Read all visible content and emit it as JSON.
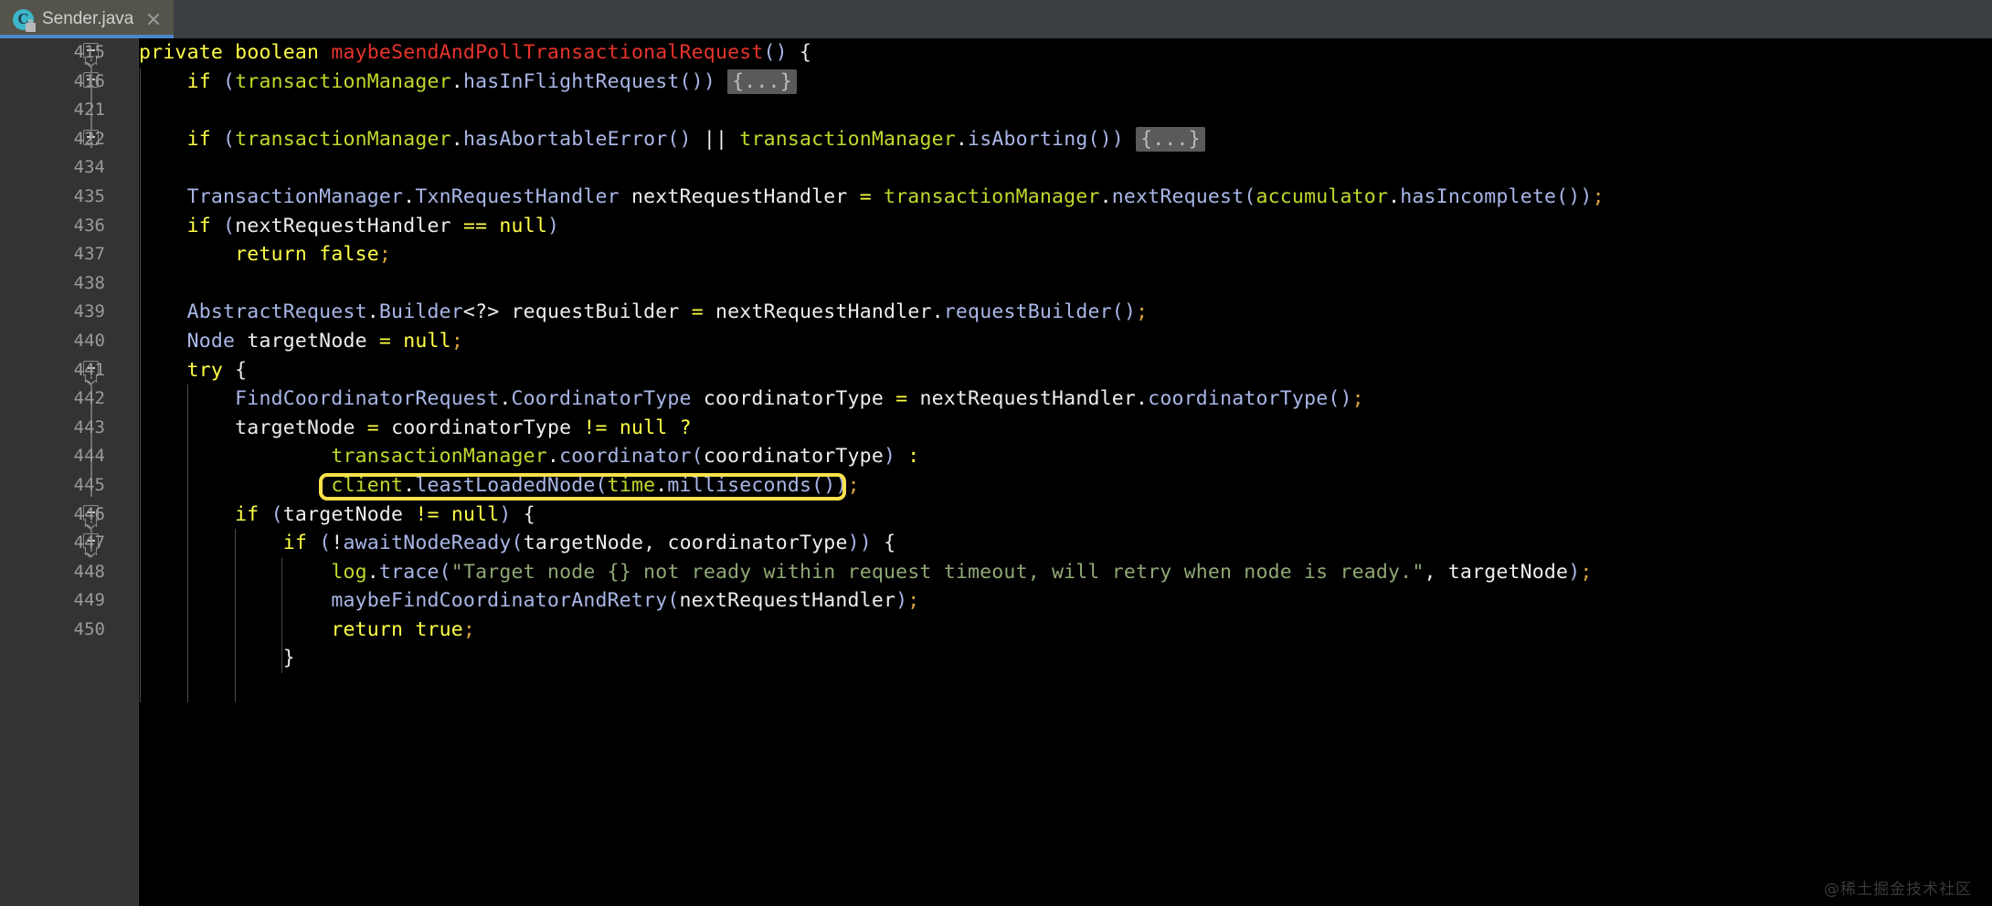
{
  "window": {
    "app": "IntelliJ IDEA Editor",
    "theme_background": "#000000",
    "gutter_background": "#313335",
    "tabbar_background": "#3c3f41"
  },
  "tab": {
    "title": "Sender.java",
    "icon": "java-class-icon",
    "icon_letter": "C",
    "icon_color": "#3eb5c8",
    "lock_badge": "lock-icon",
    "close": "close-icon",
    "active": true,
    "active_underline_color": "#4a88c7"
  },
  "highlight": {
    "color": "#fbe14a",
    "target_text": "client.leastLoadedNode(time.milliseconds())",
    "target_line": "445"
  },
  "watermark": "@稀土掘金技术社区",
  "colors": {
    "keyword": "#ffff45",
    "method_decl": "#e8342c",
    "field": "#c3d82c",
    "method_call": "#a9b7e8",
    "string": "#8fa876",
    "plain": "#e8e8e8",
    "semicolon": "#d8a33c",
    "line_number": "#9a9a9a",
    "fold_placeholder_bg": "#5a5a5a"
  },
  "editor": {
    "fold_placeholder": "{...}",
    "lines": [
      {
        "num": "415",
        "fold": "minus",
        "indent": 0,
        "tokens": [
          {
            "t": "private",
            "c": "kw"
          },
          {
            "t": " ",
            "c": "plain"
          },
          {
            "t": "boolean",
            "c": "kw"
          },
          {
            "t": " ",
            "c": "plain"
          },
          {
            "t": "maybeSendAndPollTransactionalRequest",
            "c": "mdecl"
          },
          {
            "t": "()",
            "c": "punct"
          },
          {
            "t": " ",
            "c": "plain"
          },
          {
            "t": "{",
            "c": "plain"
          }
        ]
      },
      {
        "num": "416",
        "fold": "plus",
        "indent": 1,
        "tokens": [
          {
            "t": "    ",
            "c": "plain"
          },
          {
            "t": "if",
            "c": "kw"
          },
          {
            "t": " ",
            "c": "plain"
          },
          {
            "t": "(",
            "c": "punct"
          },
          {
            "t": "transactionManager",
            "c": "var"
          },
          {
            "t": ".",
            "c": "white"
          },
          {
            "t": "hasInFlightRequest",
            "c": "meth"
          },
          {
            "t": "())",
            "c": "punct"
          },
          {
            "t": " ",
            "c": "plain"
          },
          {
            "t": "{...}",
            "c": "foldph"
          }
        ]
      },
      {
        "num": "421",
        "fold": "",
        "indent": 1,
        "tokens": []
      },
      {
        "num": "422",
        "fold": "plus",
        "indent": 1,
        "tokens": [
          {
            "t": "    ",
            "c": "plain"
          },
          {
            "t": "if",
            "c": "kw"
          },
          {
            "t": " ",
            "c": "plain"
          },
          {
            "t": "(",
            "c": "punct"
          },
          {
            "t": "transactionManager",
            "c": "var"
          },
          {
            "t": ".",
            "c": "white"
          },
          {
            "t": "hasAbortableError",
            "c": "meth"
          },
          {
            "t": "()",
            "c": "punct"
          },
          {
            "t": " ",
            "c": "plain"
          },
          {
            "t": "||",
            "c": "white"
          },
          {
            "t": " ",
            "c": "plain"
          },
          {
            "t": "transactionManager",
            "c": "var"
          },
          {
            "t": ".",
            "c": "white"
          },
          {
            "t": "isAborting",
            "c": "meth"
          },
          {
            "t": "())",
            "c": "punct"
          },
          {
            "t": " ",
            "c": "plain"
          },
          {
            "t": "{...}",
            "c": "foldph"
          }
        ]
      },
      {
        "num": "434",
        "fold": "",
        "indent": 1,
        "tokens": []
      },
      {
        "num": "435",
        "fold": "",
        "indent": 1,
        "tokens": [
          {
            "t": "    ",
            "c": "plain"
          },
          {
            "t": "TransactionManager",
            "c": "type"
          },
          {
            "t": ".",
            "c": "white"
          },
          {
            "t": "TxnRequestHandler",
            "c": "type"
          },
          {
            "t": " ",
            "c": "plain"
          },
          {
            "t": "nextRequestHandler",
            "c": "white"
          },
          {
            "t": " ",
            "c": "plain"
          },
          {
            "t": "=",
            "c": "op"
          },
          {
            "t": " ",
            "c": "plain"
          },
          {
            "t": "transactionManager",
            "c": "var"
          },
          {
            "t": ".",
            "c": "white"
          },
          {
            "t": "nextRequest",
            "c": "meth"
          },
          {
            "t": "(",
            "c": "punct"
          },
          {
            "t": "accumulator",
            "c": "var"
          },
          {
            "t": ".",
            "c": "white"
          },
          {
            "t": "hasIncomplete",
            "c": "meth"
          },
          {
            "t": "())",
            "c": "punct"
          },
          {
            "t": ";",
            "c": "semi"
          }
        ]
      },
      {
        "num": "436",
        "fold": "",
        "indent": 1,
        "tokens": [
          {
            "t": "    ",
            "c": "plain"
          },
          {
            "t": "if",
            "c": "kw"
          },
          {
            "t": " ",
            "c": "plain"
          },
          {
            "t": "(",
            "c": "punct"
          },
          {
            "t": "nextRequestHandler",
            "c": "white"
          },
          {
            "t": " ",
            "c": "plain"
          },
          {
            "t": "==",
            "c": "op"
          },
          {
            "t": " ",
            "c": "plain"
          },
          {
            "t": "null",
            "c": "kw"
          },
          {
            "t": ")",
            "c": "punct"
          }
        ]
      },
      {
        "num": "437",
        "fold": "",
        "indent": 2,
        "tokens": [
          {
            "t": "        ",
            "c": "plain"
          },
          {
            "t": "return",
            "c": "kw"
          },
          {
            "t": " ",
            "c": "plain"
          },
          {
            "t": "false",
            "c": "kw"
          },
          {
            "t": ";",
            "c": "semi"
          }
        ]
      },
      {
        "num": "438",
        "fold": "",
        "indent": 1,
        "tokens": []
      },
      {
        "num": "439",
        "fold": "",
        "indent": 1,
        "tokens": [
          {
            "t": "    ",
            "c": "plain"
          },
          {
            "t": "AbstractRequest",
            "c": "type"
          },
          {
            "t": ".",
            "c": "white"
          },
          {
            "t": "Builder",
            "c": "type"
          },
          {
            "t": "<?>",
            "c": "white"
          },
          {
            "t": " ",
            "c": "plain"
          },
          {
            "t": "requestBuilder",
            "c": "white"
          },
          {
            "t": " ",
            "c": "plain"
          },
          {
            "t": "=",
            "c": "op"
          },
          {
            "t": " ",
            "c": "plain"
          },
          {
            "t": "nextRequestHandler",
            "c": "white"
          },
          {
            "t": ".",
            "c": "white"
          },
          {
            "t": "requestBuilder",
            "c": "meth"
          },
          {
            "t": "()",
            "c": "punct"
          },
          {
            "t": ";",
            "c": "semi"
          }
        ]
      },
      {
        "num": "440",
        "fold": "",
        "indent": 1,
        "tokens": [
          {
            "t": "    ",
            "c": "plain"
          },
          {
            "t": "Node",
            "c": "type"
          },
          {
            "t": " ",
            "c": "plain"
          },
          {
            "t": "targetNode",
            "c": "white"
          },
          {
            "t": " ",
            "c": "plain"
          },
          {
            "t": "=",
            "c": "op"
          },
          {
            "t": " ",
            "c": "plain"
          },
          {
            "t": "null",
            "c": "kw"
          },
          {
            "t": ";",
            "c": "semi"
          }
        ]
      },
      {
        "num": "441",
        "fold": "minus",
        "indent": 1,
        "tokens": [
          {
            "t": "    ",
            "c": "plain"
          },
          {
            "t": "try",
            "c": "kw"
          },
          {
            "t": " ",
            "c": "plain"
          },
          {
            "t": "{",
            "c": "plain"
          }
        ]
      },
      {
        "num": "442",
        "fold": "",
        "indent": 2,
        "tokens": [
          {
            "t": "        ",
            "c": "plain"
          },
          {
            "t": "FindCoordinatorRequest",
            "c": "type"
          },
          {
            "t": ".",
            "c": "white"
          },
          {
            "t": "CoordinatorType",
            "c": "type"
          },
          {
            "t": " ",
            "c": "plain"
          },
          {
            "t": "coordinatorType",
            "c": "white"
          },
          {
            "t": " ",
            "c": "plain"
          },
          {
            "t": "=",
            "c": "op"
          },
          {
            "t": " ",
            "c": "plain"
          },
          {
            "t": "nextRequestHandler",
            "c": "white"
          },
          {
            "t": ".",
            "c": "white"
          },
          {
            "t": "coordinatorType",
            "c": "meth"
          },
          {
            "t": "()",
            "c": "punct"
          },
          {
            "t": ";",
            "c": "semi"
          }
        ]
      },
      {
        "num": "443",
        "fold": "",
        "indent": 2,
        "tokens": [
          {
            "t": "        ",
            "c": "plain"
          },
          {
            "t": "targetNode",
            "c": "white"
          },
          {
            "t": " ",
            "c": "plain"
          },
          {
            "t": "=",
            "c": "op"
          },
          {
            "t": " ",
            "c": "plain"
          },
          {
            "t": "coordinatorType",
            "c": "white"
          },
          {
            "t": " ",
            "c": "plain"
          },
          {
            "t": "!=",
            "c": "op"
          },
          {
            "t": " ",
            "c": "plain"
          },
          {
            "t": "null",
            "c": "kw"
          },
          {
            "t": " ",
            "c": "plain"
          },
          {
            "t": "?",
            "c": "op"
          }
        ]
      },
      {
        "num": "444",
        "fold": "",
        "indent": 3,
        "tokens": [
          {
            "t": "                ",
            "c": "plain"
          },
          {
            "t": "transactionManager",
            "c": "var"
          },
          {
            "t": ".",
            "c": "white"
          },
          {
            "t": "coordinator",
            "c": "meth"
          },
          {
            "t": "(",
            "c": "punct"
          },
          {
            "t": "coordinatorType",
            "c": "white"
          },
          {
            "t": ")",
            "c": "punct"
          },
          {
            "t": " ",
            "c": "plain"
          },
          {
            "t": ":",
            "c": "op"
          }
        ]
      },
      {
        "num": "445",
        "fold": "",
        "indent": 3,
        "highlighted": true,
        "tokens": [
          {
            "t": "                ",
            "c": "plain"
          },
          {
            "t": "client",
            "c": "var"
          },
          {
            "t": ".",
            "c": "white"
          },
          {
            "t": "leastLoadedNode",
            "c": "meth"
          },
          {
            "t": "(",
            "c": "punct"
          },
          {
            "t": "time",
            "c": "var"
          },
          {
            "t": ".",
            "c": "white"
          },
          {
            "t": "milliseconds",
            "c": "meth"
          },
          {
            "t": "())",
            "c": "punct"
          },
          {
            "t": ";",
            "c": "semi"
          }
        ]
      },
      {
        "num": "446",
        "fold": "minus",
        "indent": 2,
        "tokens": [
          {
            "t": "        ",
            "c": "plain"
          },
          {
            "t": "if",
            "c": "kw"
          },
          {
            "t": " ",
            "c": "plain"
          },
          {
            "t": "(",
            "c": "punct"
          },
          {
            "t": "targetNode",
            "c": "white"
          },
          {
            "t": " ",
            "c": "plain"
          },
          {
            "t": "!=",
            "c": "op"
          },
          {
            "t": " ",
            "c": "plain"
          },
          {
            "t": "null",
            "c": "kw"
          },
          {
            "t": ")",
            "c": "punct"
          },
          {
            "t": " ",
            "c": "plain"
          },
          {
            "t": "{",
            "c": "plain"
          }
        ]
      },
      {
        "num": "447",
        "fold": "minus",
        "indent": 3,
        "tokens": [
          {
            "t": "            ",
            "c": "plain"
          },
          {
            "t": "if",
            "c": "kw"
          },
          {
            "t": " ",
            "c": "plain"
          },
          {
            "t": "(",
            "c": "punct"
          },
          {
            "t": "!",
            "c": "white"
          },
          {
            "t": "awaitNodeReady",
            "c": "meth"
          },
          {
            "t": "(",
            "c": "punct"
          },
          {
            "t": "targetNode",
            "c": "white"
          },
          {
            "t": ", ",
            "c": "white"
          },
          {
            "t": "coordinatorType",
            "c": "white"
          },
          {
            "t": "))",
            "c": "punct"
          },
          {
            "t": " ",
            "c": "plain"
          },
          {
            "t": "{",
            "c": "plain"
          }
        ]
      },
      {
        "num": "448",
        "fold": "",
        "indent": 4,
        "tokens": [
          {
            "t": "                ",
            "c": "plain"
          },
          {
            "t": "log",
            "c": "var"
          },
          {
            "t": ".",
            "c": "white"
          },
          {
            "t": "trace",
            "c": "meth"
          },
          {
            "t": "(",
            "c": "punct"
          },
          {
            "t": "\"Target node {} not ready within request timeout, will retry when node is ready.\"",
            "c": "str"
          },
          {
            "t": ", ",
            "c": "white"
          },
          {
            "t": "targetNode",
            "c": "white"
          },
          {
            "t": ")",
            "c": "punct"
          },
          {
            "t": ";",
            "c": "semi"
          }
        ]
      },
      {
        "num": "449",
        "fold": "",
        "indent": 4,
        "tokens": [
          {
            "t": "                ",
            "c": "plain"
          },
          {
            "t": "maybeFindCoordinatorAndRetry",
            "c": "meth"
          },
          {
            "t": "(",
            "c": "punct"
          },
          {
            "t": "nextRequestHandler",
            "c": "white"
          },
          {
            "t": ")",
            "c": "punct"
          },
          {
            "t": ";",
            "c": "semi"
          }
        ]
      },
      {
        "num": "450",
        "fold": "",
        "indent": 4,
        "tokens": [
          {
            "t": "                ",
            "c": "plain"
          },
          {
            "t": "return",
            "c": "kw"
          },
          {
            "t": " ",
            "c": "plain"
          },
          {
            "t": "true",
            "c": "kw"
          },
          {
            "t": ";",
            "c": "semi"
          }
        ]
      },
      {
        "num": "",
        "fold": "",
        "indent": 3,
        "tokens": [
          {
            "t": "            ",
            "c": "plain"
          },
          {
            "t": "}",
            "c": "plain"
          }
        ]
      }
    ]
  }
}
